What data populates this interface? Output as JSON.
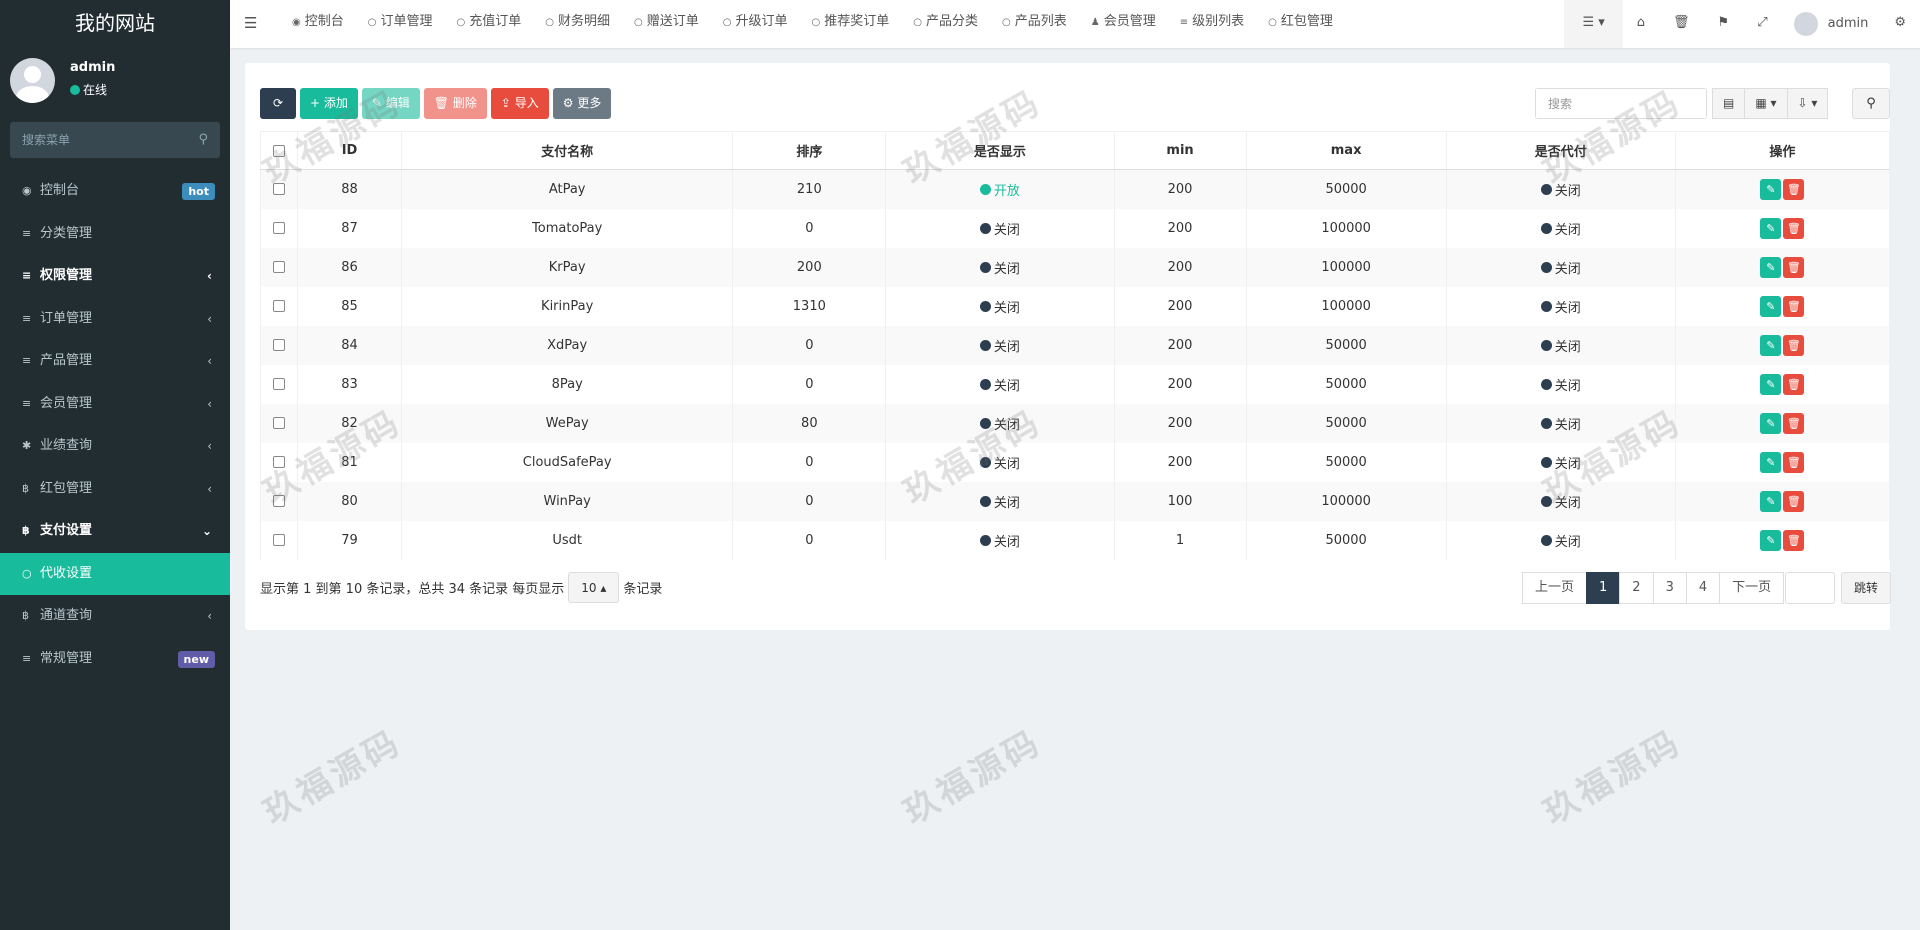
{
  "site_title": "我的网站",
  "user": {
    "name": "admin",
    "status": "在线"
  },
  "sidebar_search_placeholder": "搜索菜单",
  "menu": [
    {
      "label": "控制台",
      "badge": "hot",
      "badge_color": "#3c8dbc"
    },
    {
      "label": "分类管理"
    },
    {
      "label": "权限管理",
      "arrow": "‹"
    },
    {
      "label": "订单管理",
      "arrow": "‹"
    },
    {
      "label": "产品管理",
      "arrow": "‹"
    },
    {
      "label": "会员管理",
      "arrow": "‹"
    },
    {
      "label": "业绩查询",
      "arrow": "‹"
    },
    {
      "label": "红包管理",
      "arrow": "‹"
    },
    {
      "label": "支付设置",
      "arrow": "⌄"
    },
    {
      "label": "代收设置"
    },
    {
      "label": "通道查询",
      "arrow": "‹"
    },
    {
      "label": "常规管理",
      "badge": "new",
      "badge_color": "#605ca8"
    }
  ],
  "tabs": [
    "控制台",
    "订单管理",
    "充值订单",
    "财务明细",
    "赠送订单",
    "升级订单",
    "推荐奖订单",
    "产品分类",
    "产品列表",
    "会员管理",
    "级别列表",
    "红包管理"
  ],
  "topbar_user": "admin",
  "toolbar": {
    "add": "添加",
    "edit": "编辑",
    "delete": "删除",
    "import": "导入",
    "more": "更多"
  },
  "search_placeholder": "搜索",
  "columns": [
    "ID",
    "支付名称",
    "排序",
    "是否显示",
    "min",
    "max",
    "是否代付",
    "操作"
  ],
  "rows": [
    {
      "id": "88",
      "name": "AtPay",
      "sort": "210",
      "show": "开放",
      "show_on": true,
      "min": "200",
      "max": "50000",
      "payout": "关闭"
    },
    {
      "id": "87",
      "name": "TomatoPay",
      "sort": "0",
      "show": "关闭",
      "show_on": false,
      "min": "200",
      "max": "100000",
      "payout": "关闭"
    },
    {
      "id": "86",
      "name": "KrPay",
      "sort": "200",
      "show": "关闭",
      "show_on": false,
      "min": "200",
      "max": "100000",
      "payout": "关闭"
    },
    {
      "id": "85",
      "name": "KirinPay",
      "sort": "1310",
      "show": "关闭",
      "show_on": false,
      "min": "200",
      "max": "100000",
      "payout": "关闭"
    },
    {
      "id": "84",
      "name": "XdPay",
      "sort": "0",
      "show": "关闭",
      "show_on": false,
      "min": "200",
      "max": "50000",
      "payout": "关闭"
    },
    {
      "id": "83",
      "name": "8Pay",
      "sort": "0",
      "show": "关闭",
      "show_on": false,
      "min": "200",
      "max": "50000",
      "payout": "关闭"
    },
    {
      "id": "82",
      "name": "WePay",
      "sort": "80",
      "show": "关闭",
      "show_on": false,
      "min": "200",
      "max": "50000",
      "payout": "关闭"
    },
    {
      "id": "81",
      "name": "CloudSafePay",
      "sort": "0",
      "show": "关闭",
      "show_on": false,
      "min": "200",
      "max": "50000",
      "payout": "关闭"
    },
    {
      "id": "80",
      "name": "WinPay",
      "sort": "0",
      "show": "关闭",
      "show_on": false,
      "min": "100",
      "max": "100000",
      "payout": "关闭"
    },
    {
      "id": "79",
      "name": "Usdt",
      "sort": "0",
      "show": "关闭",
      "show_on": false,
      "min": "1",
      "max": "50000",
      "payout": "关闭"
    }
  ],
  "pagination": {
    "info_pre": "显示第 1 到第 10 条记录，总共 34 条记录 每页显示",
    "page_size": "10 ▴",
    "info_post": "条记录",
    "prev": "上一页",
    "pages": [
      "1",
      "2",
      "3",
      "4"
    ],
    "next": "下一页",
    "jump": "跳转"
  },
  "watermark": "玖福源码"
}
